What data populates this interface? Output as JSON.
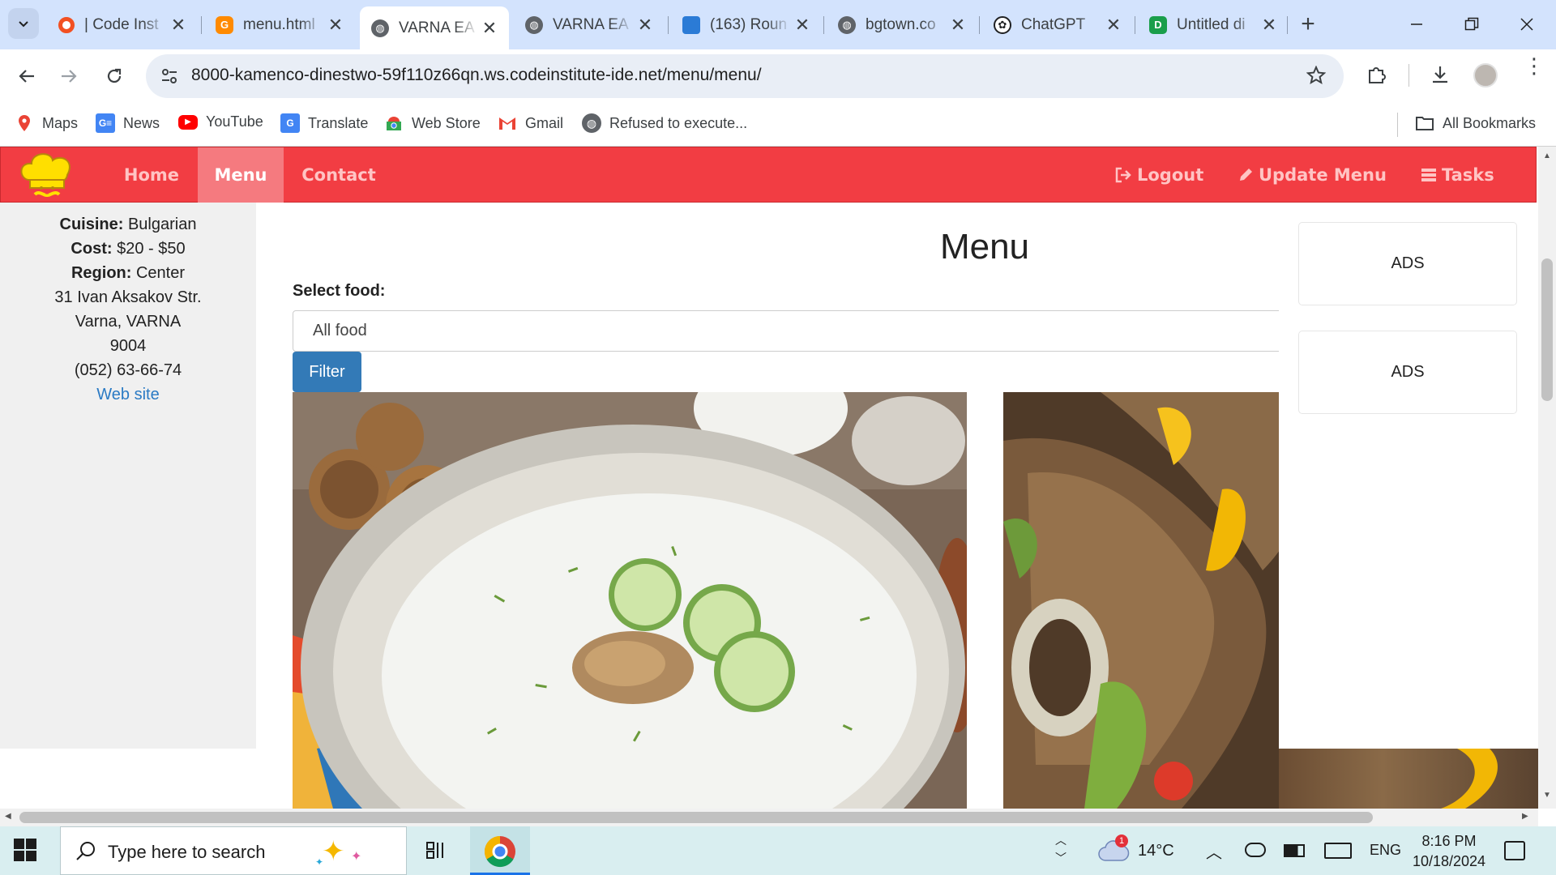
{
  "tabs": [
    {
      "title": "| Code Inst",
      "icon": "opera-icon",
      "color": "#f25022"
    },
    {
      "title": "menu.html",
      "icon": "gitpod-icon",
      "color": "#ff8a00"
    },
    {
      "title": "VARNA EA",
      "icon": "globe-icon",
      "color": "#5f6368",
      "active": true
    },
    {
      "title": "VARNA EA",
      "icon": "globe-icon",
      "color": "#5f6368"
    },
    {
      "title": "(163) Roun",
      "icon": "cube-icon",
      "color": "#2b7bd6"
    },
    {
      "title": "bgtown.co",
      "icon": "globe-icon",
      "color": "#5f6368"
    },
    {
      "title": "ChatGPT",
      "icon": "openai-icon",
      "color": "#202123"
    },
    {
      "title": "Untitled di",
      "icon": "draw-icon",
      "color": "#1a9e4b"
    }
  ],
  "address_bar": {
    "url": "8000-kamenco-dinestwo-59f110z66qn.ws.codeinstitute-ide.net/menu/menu/"
  },
  "bookmarks": [
    "Maps",
    "News",
    "YouTube",
    "Translate",
    "Web Store",
    "Gmail",
    "Refused to execute..."
  ],
  "all_bookmarks": "All Bookmarks",
  "site_nav": {
    "links": [
      "Home",
      "Menu",
      "Contact"
    ],
    "right_links": [
      "Logout",
      "Update Menu",
      "Tasks"
    ],
    "brand_color": "#f23d43"
  },
  "restaurant": {
    "cuisine_label": "Cuisine:",
    "cuisine": "Bulgarian",
    "cost_label": "Cost:",
    "cost": "$20 - $50",
    "region_label": "Region:",
    "region": "Center",
    "street": "31 Ivan Aksakov Str.",
    "city": "Varna, VARNA",
    "zip": "9004",
    "phone": "(052) 63-66-74",
    "website": "Web site"
  },
  "menu": {
    "title": "Menu",
    "select_label": "Select food:",
    "selected_option": "All food",
    "filter_button": "Filter"
  },
  "ads": [
    "ADS",
    "ADS"
  ],
  "taskbar": {
    "search_placeholder": "Type here to search",
    "weather": "14°C",
    "weather_badge": "1",
    "language": "ENG",
    "time": "8:16 PM",
    "date": "10/18/2024"
  }
}
